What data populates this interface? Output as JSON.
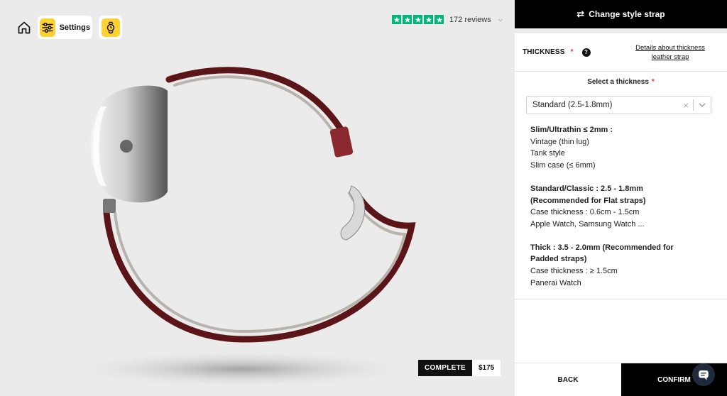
{
  "toolbar": {
    "settings_label": "Settings"
  },
  "trustpilot": {
    "stars": 5,
    "reviews_label": "172 reviews"
  },
  "price": {
    "complete_label": "COMPLETE",
    "amount": "$175"
  },
  "panel": {
    "header_title": "Change style strap",
    "thickness_title": "THICKNESS",
    "required_mark": "*",
    "help_label": "?",
    "details_link": "Details about thickness leather strap",
    "select_label": "Select a thickness",
    "select_value": "Standard (2.5-1.8mm)",
    "options": [
      {
        "title": "Slim/Ultrathin ≤ 2mm :",
        "lines": [
          "Vintage (thin lug)",
          "Tank style",
          "Slim case (≤ 6mm)"
        ]
      },
      {
        "title": "Standard/Classic : 2.5 - 1.8mm (Recommended for Flat straps)",
        "lines": [
          "Case thickness : 0.6cm - 1.5cm",
          "Apple Watch, Samsung Watch ..."
        ]
      },
      {
        "title": "Thick : 3.5 - 2.0mm (Recommended for Padded straps)",
        "lines": [
          "Case thickness : ≥ 1.5cm",
          "Panerai Watch"
        ]
      }
    ],
    "back_label": "BACK",
    "confirm_label": "CONFIRM"
  },
  "colors": {
    "accent_yellow": "#ffd233",
    "trustpilot_green": "#00b67a",
    "strap_red": "#6b1a1f",
    "panel_black": "#000000"
  },
  "icons": [
    "home-icon",
    "sliders-icon",
    "watch-icon",
    "star-icon",
    "swap-icon",
    "help-icon",
    "clear-icon",
    "chevron-down-icon",
    "chat-icon"
  ]
}
